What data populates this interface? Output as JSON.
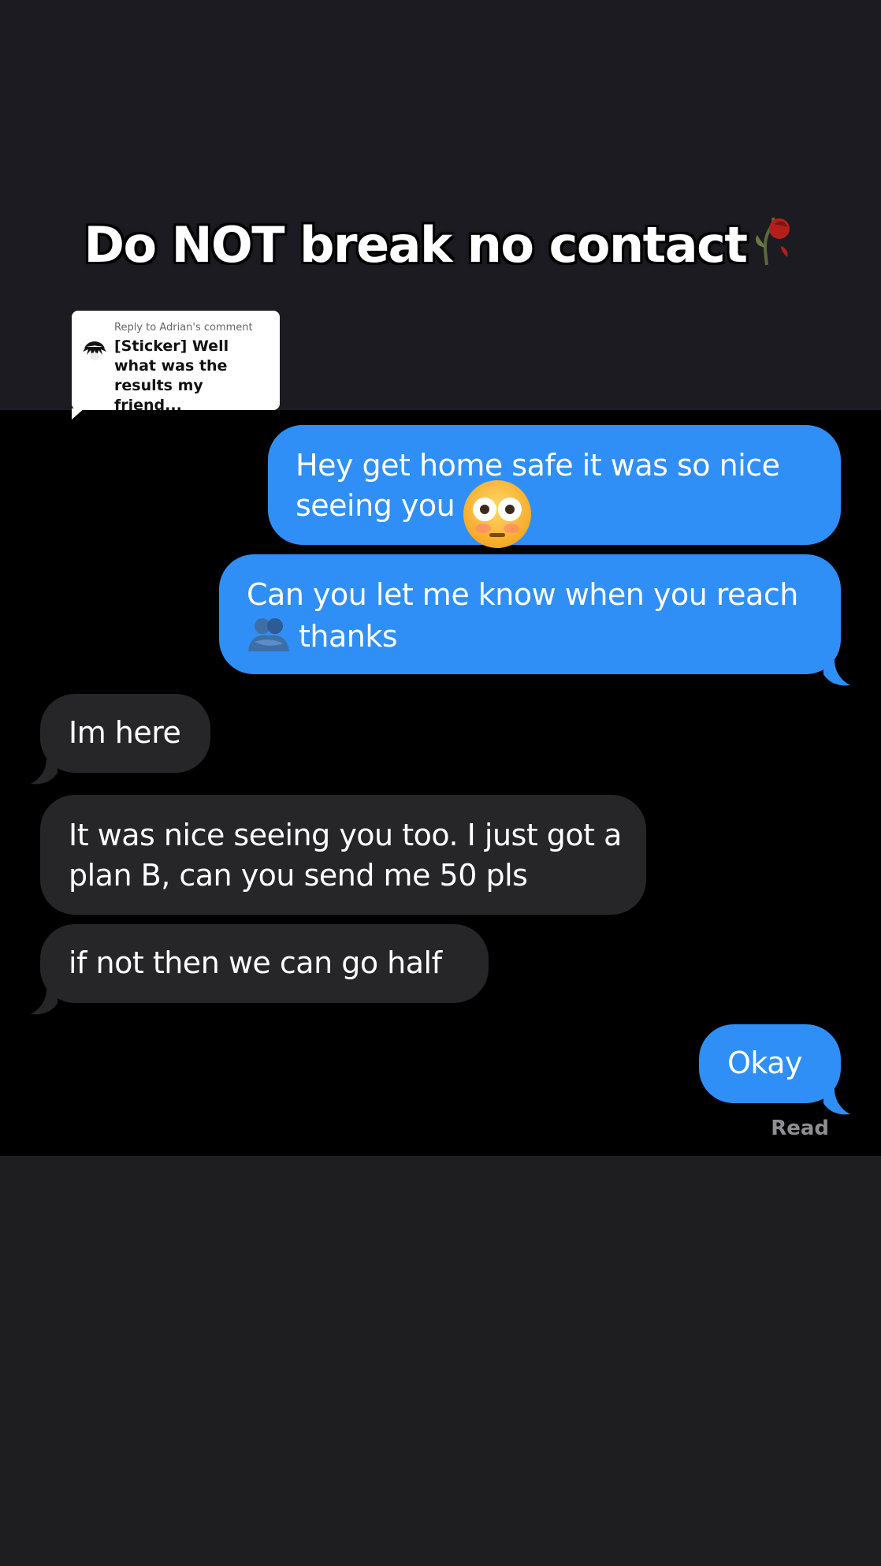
{
  "overlay": {
    "title": "Do NOT break no contact",
    "title_icon": "wilted-rose-icon"
  },
  "reply_card": {
    "meta": "Reply to Adrian's comment",
    "text": "[Sticker] Well what was the results my friend..."
  },
  "messages": [
    {
      "direction": "sent",
      "text": "Hey get home safe it was so nice seeing you",
      "trailing_icon": "flushed-face-emoji"
    },
    {
      "direction": "sent",
      "text": "Can you let me know when you reach",
      "inline_icon": "people-hugging-emoji",
      "text_after_icon": "thanks"
    },
    {
      "direction": "received",
      "text": "Im here"
    },
    {
      "direction": "received",
      "text": "It was nice seeing you too. I just got a plan B, can you send me 50 pls"
    },
    {
      "direction": "received",
      "text": "if not then we can go half"
    },
    {
      "direction": "sent",
      "text": "Okay"
    }
  ],
  "status": {
    "read_label": "Read"
  },
  "colors": {
    "sent_bubble": "#2f8ff7",
    "received_bubble": "#262628",
    "chat_background": "#000000",
    "page_background": "#1e1e20"
  }
}
